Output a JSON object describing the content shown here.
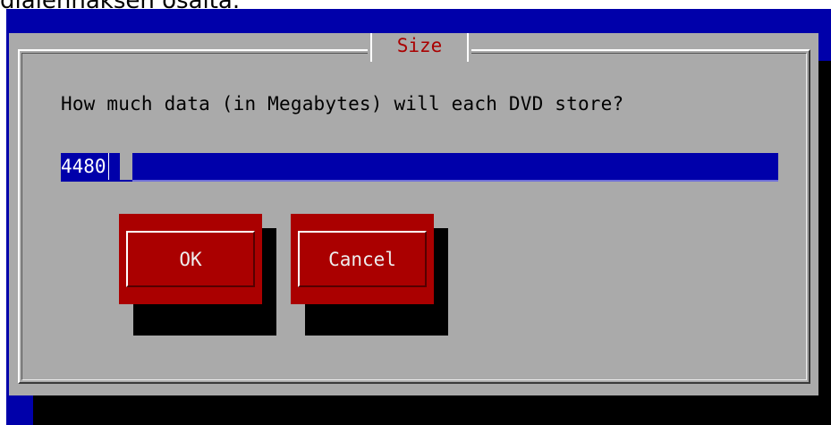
{
  "top_text": "dialenhaksen osalta.",
  "dialog": {
    "title": "Size",
    "prompt": "How much data (in Megabytes) will each DVD store?",
    "input_value": "4480"
  },
  "buttons": {
    "ok_label": "OK",
    "cancel_label": "Cancel"
  },
  "colors": {
    "background": "#0000aa",
    "dialog": "#aaaaaa",
    "title": "#aa0000",
    "button": "#aa0000",
    "input": "#0000aa"
  }
}
